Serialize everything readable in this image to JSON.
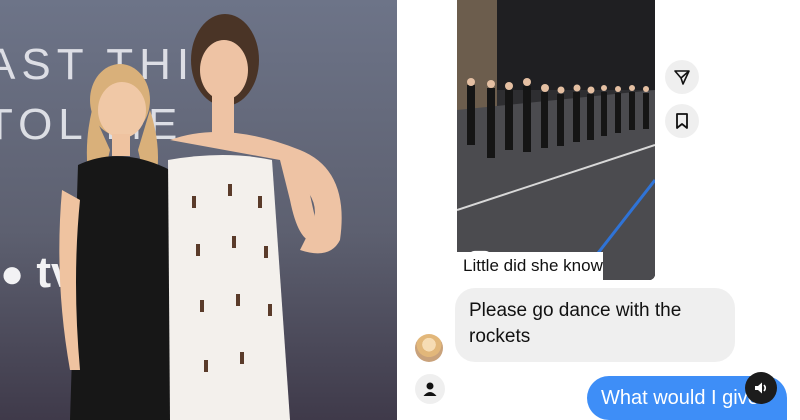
{
  "photo": {
    "backdrop_line1": "AST THIN",
    "backdrop_line2": "TOL ME",
    "brand_text": "tv"
  },
  "reel": {
    "caption": "Little did she know"
  },
  "chat": {
    "incoming_message": "Please go dance with the rockets",
    "outgoing_message": "What would I give"
  },
  "colors": {
    "outgoing_bubble": "#3e8ef7",
    "incoming_bubble": "#efefef",
    "reel_bg": "#303033"
  },
  "icons": {
    "share": "paper-plane-icon",
    "save": "bookmark-icon",
    "reel": "reels-icon",
    "mute": "speaker-icon",
    "profile": "person-icon"
  }
}
